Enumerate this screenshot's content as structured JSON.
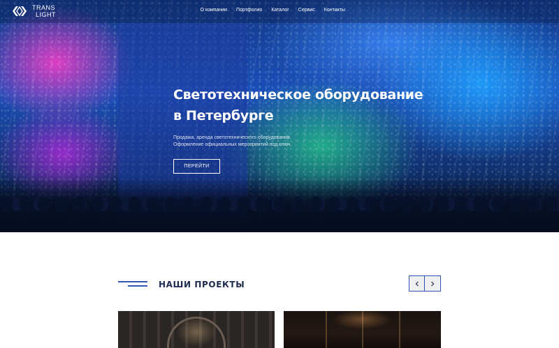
{
  "header": {
    "logo": {
      "line1": "TRANS",
      "line2": "LIGHT"
    },
    "nav": [
      {
        "label": "О компании"
      },
      {
        "label": "Портфолио"
      },
      {
        "label": "Каталог"
      },
      {
        "label": "Сервис"
      },
      {
        "label": "Контакты"
      }
    ]
  },
  "hero": {
    "title_line1": "Светотехническое оборудование",
    "title_line2": "в Петербурге",
    "desc_line1": "Продажа, аренда светотехнического оборудования.",
    "desc_line2": "Оформление официальных мероприятий под ключ.",
    "button_label": "ПЕРЕЙТИ"
  },
  "projects": {
    "title": "НАШИ ПРОЕКТЫ",
    "prev_icon": "chevron-left-icon",
    "next_icon": "chevron-right-icon"
  },
  "colors": {
    "accent": "#2d56b4",
    "heading": "#1d2a4f",
    "hero_overlay": "#1e3ca0"
  }
}
